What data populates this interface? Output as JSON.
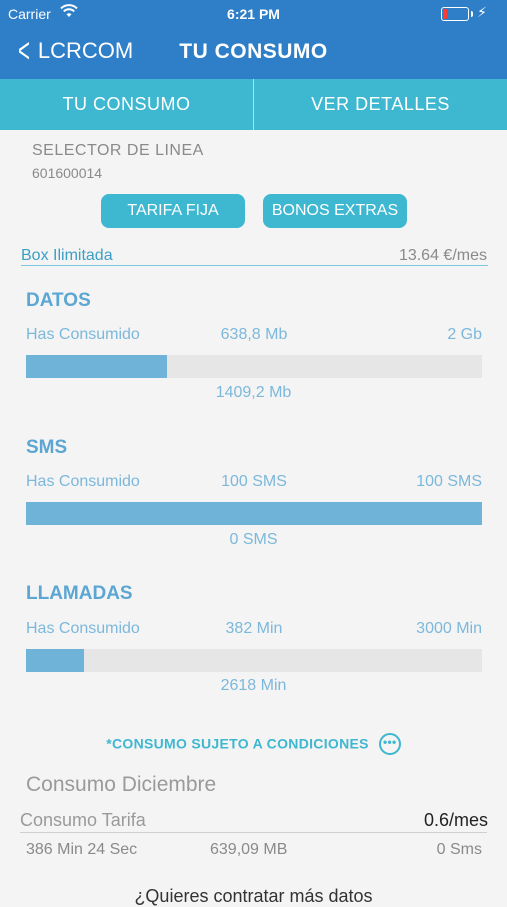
{
  "status": {
    "carrier": "Carrier",
    "time": "6:21 PM"
  },
  "nav": {
    "back_label": "LCRCOM",
    "title": "TU CONSUMO"
  },
  "tabs": [
    {
      "label": "TU CONSUMO"
    },
    {
      "label": "VER DETALLES"
    }
  ],
  "selector": {
    "title": "SELECTOR DE LINEA",
    "number": "601600014"
  },
  "buttons": {
    "tarifa": "TARIFA FIJA",
    "bonos": "BONOS EXTRAS"
  },
  "plan": {
    "name": "Box Ilimitada",
    "price": "13.64 €/mes"
  },
  "sections": {
    "datos": {
      "title": "DATOS",
      "used_label": "Has Consumido",
      "used": "638,8 Mb",
      "total": "2 Gb",
      "remaining": "1409,2 Mb",
      "progress": 0.31
    },
    "sms": {
      "title": "SMS",
      "used_label": "Has Consumido",
      "used": "100 SMS",
      "total": "100 SMS",
      "remaining": "0 SMS",
      "progress": 1.0
    },
    "llamadas": {
      "title": "LLAMADAS",
      "used_label": "Has Consumido",
      "used": "382 Min",
      "total": "3000 Min",
      "remaining": "2618 Min",
      "progress": 0.127
    }
  },
  "conditions": "*CONSUMO SUJETO A CONDICIONES",
  "consumo": {
    "title": "Consumo Diciembre",
    "tarifa_label": "Consumo Tarifa",
    "tarifa_value": "0.6/mes",
    "minutes": "386 Min 24 Sec",
    "data": "639,09 MB",
    "sms": "0 Sms"
  },
  "more_text": "¿Quieres contratar más datos",
  "colors": {
    "header": "#2e7fc8",
    "accent": "#3eb7d0",
    "bar_fill": "#6fb3d9",
    "bar_bg": "#e6e6e6"
  },
  "icons": [
    "wifi-icon",
    "battery-icon",
    "charging-bolt-icon",
    "back-chevron-icon",
    "more-dots-icon"
  ]
}
